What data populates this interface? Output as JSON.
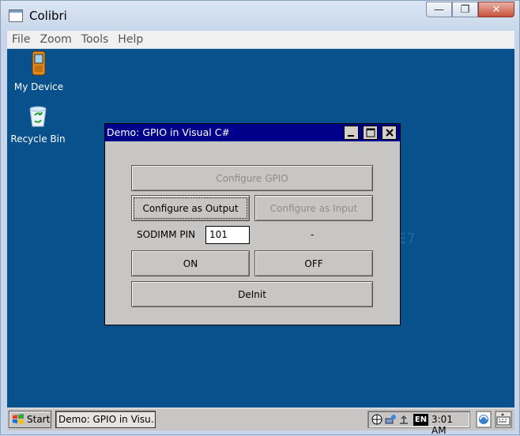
{
  "host_window": {
    "title": "Colibri",
    "menu": [
      "File",
      "Zoom",
      "Tools",
      "Help"
    ],
    "buttons": {
      "minimize": "—",
      "maximize": "❐",
      "close": "✕"
    }
  },
  "desktop": {
    "icons": [
      {
        "label": "My Device"
      },
      {
        "label": "Recycle Bin"
      }
    ],
    "watermark": "E7"
  },
  "dialog": {
    "title": "Demo: GPIO in Visual C#",
    "configure_gpio_label": "Configure GPIO",
    "configure_output_label": "Configure as Output",
    "configure_input_label": "Configure as Input",
    "pin_label": "SODIMM PIN",
    "pin_value": "101",
    "state_text": "-",
    "on_label": "ON",
    "off_label": "OFF",
    "deinit_label": "DeInit"
  },
  "taskbar": {
    "start_label": "Start",
    "task_label": "Demo: GPIO in Visu...",
    "lang": "EN",
    "time": "3:01 AM"
  }
}
